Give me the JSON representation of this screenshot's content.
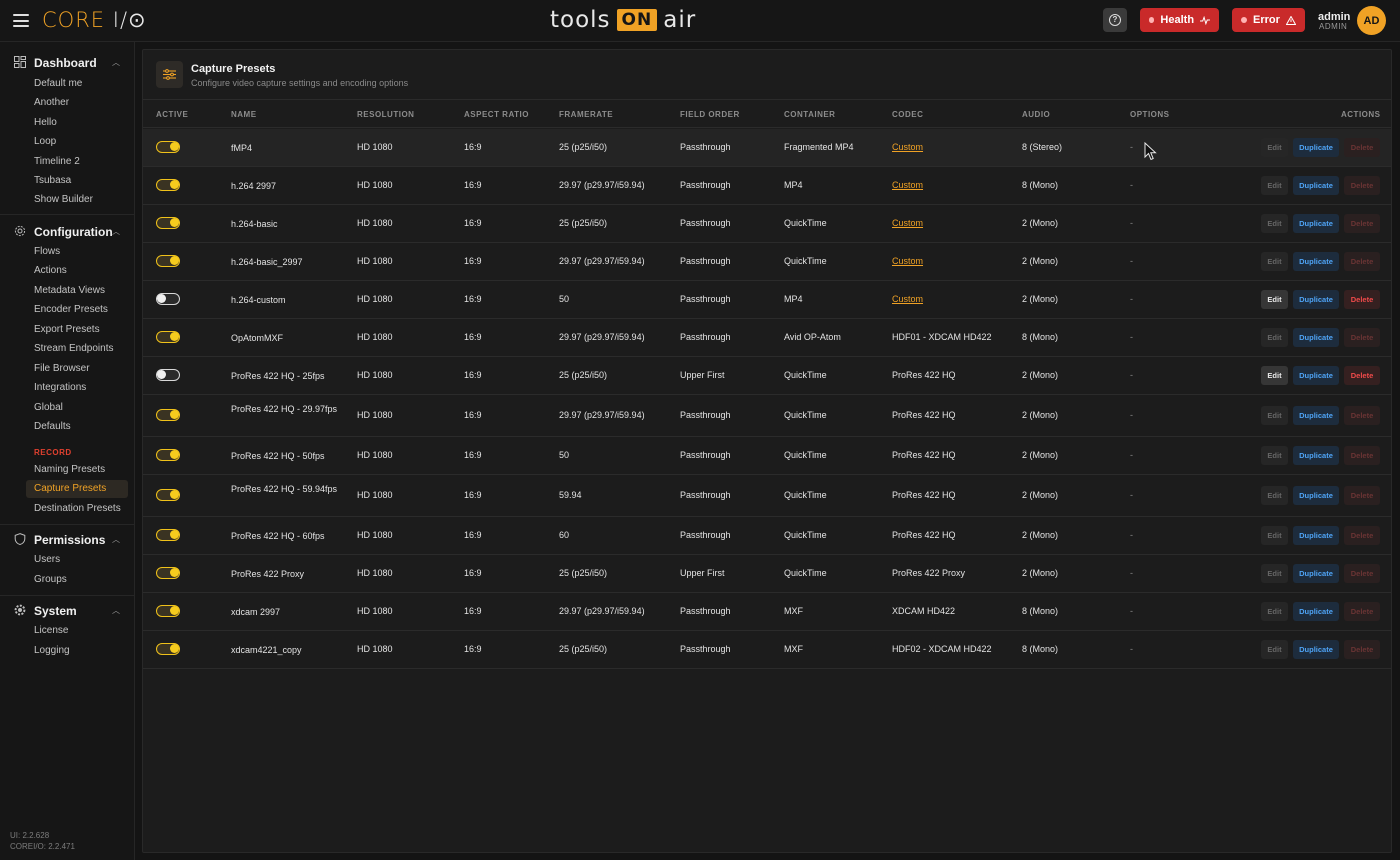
{
  "app": {
    "brand_core": "CORE",
    "brand_io": "I/⊙",
    "partner_logo": "tools",
    "partner_logo_on": "ON",
    "partner_logo_air": "air"
  },
  "topbar": {
    "health_label": "Health",
    "error_label": "Error",
    "user_name": "admin",
    "user_role": "ADMIN",
    "avatar_initials": "AD"
  },
  "sidebar": {
    "dashboard": {
      "label": "Dashboard",
      "items": [
        "Default me",
        "Another",
        "Hello",
        "Loop",
        "Timeline 2",
        "Tsubasa",
        "Show Builder"
      ]
    },
    "configuration": {
      "label": "Configuration",
      "items": [
        "Flows",
        "Actions",
        "Metadata Views",
        "Encoder Presets",
        "Export Presets",
        "Stream Endpoints",
        "File Browser",
        "Integrations",
        "Global",
        "Defaults"
      ]
    },
    "record": {
      "label": "RECORD",
      "items": [
        "Naming Presets",
        "Capture Presets",
        "Destination Presets"
      ]
    },
    "permissions": {
      "label": "Permissions",
      "items": [
        "Users",
        "Groups"
      ]
    },
    "system": {
      "label": "System",
      "items": [
        "License",
        "Logging"
      ]
    },
    "version_ui": "UI: 2.2.628",
    "version_core": "COREI/O: 2.2.471"
  },
  "page": {
    "title": "Capture Presets",
    "subtitle": "Configure video capture settings and encoding options"
  },
  "table": {
    "headers": {
      "active": "ACTIVE",
      "name": "NAME",
      "resolution": "RESOLUTION",
      "aspect": "ASPECT RATIO",
      "framerate": "FRAMERATE",
      "field_order": "FIELD ORDER",
      "container": "CONTAINER",
      "codec": "CODEC",
      "audio": "AUDIO",
      "options": "OPTIONS",
      "actions": "ACTIONS"
    },
    "button_labels": {
      "edit": "Edit",
      "duplicate": "Duplicate",
      "delete": "Delete"
    },
    "rows": [
      {
        "active": true,
        "name": "fMP4",
        "resolution": "HD 1080",
        "aspect": "16:9",
        "framerate": "25 (p25/i50)",
        "field_order": "Passthrough",
        "container": "Fragmented MP4",
        "codec": "Custom",
        "codec_link": true,
        "audio": "8 (Stereo)",
        "options": "-"
      },
      {
        "active": true,
        "name": "h.264 2997",
        "resolution": "HD 1080",
        "aspect": "16:9",
        "framerate": "29.97 (p29.97/i59.94)",
        "field_order": "Passthrough",
        "container": "MP4",
        "codec": "Custom",
        "codec_link": true,
        "audio": "8 (Mono)",
        "options": "-"
      },
      {
        "active": true,
        "name": "h.264-basic",
        "resolution": "HD 1080",
        "aspect": "16:9",
        "framerate": "25 (p25/i50)",
        "field_order": "Passthrough",
        "container": "QuickTime",
        "codec": "Custom",
        "codec_link": true,
        "audio": "2 (Mono)",
        "options": "-"
      },
      {
        "active": true,
        "name": "h.264-basic_2997",
        "resolution": "HD 1080",
        "aspect": "16:9",
        "framerate": "29.97 (p29.97/i59.94)",
        "field_order": "Passthrough",
        "container": "QuickTime",
        "codec": "Custom",
        "codec_link": true,
        "audio": "2 (Mono)",
        "options": "-"
      },
      {
        "active": false,
        "name": "h.264-custom",
        "resolution": "HD 1080",
        "aspect": "16:9",
        "framerate": "50",
        "field_order": "Passthrough",
        "container": "MP4",
        "codec": "Custom",
        "codec_link": true,
        "audio": "2 (Mono)",
        "options": "-"
      },
      {
        "active": true,
        "name": "OpAtomMXF",
        "resolution": "HD 1080",
        "aspect": "16:9",
        "framerate": "29.97 (p29.97/i59.94)",
        "field_order": "Passthrough",
        "container": "Avid OP-Atom",
        "codec": "HDF01 - XDCAM HD422",
        "codec_link": false,
        "audio": "8 (Mono)",
        "options": "-"
      },
      {
        "active": false,
        "name": "ProRes 422 HQ - 25fps",
        "resolution": "HD 1080",
        "aspect": "16:9",
        "framerate": "25 (p25/i50)",
        "field_order": "Upper First",
        "container": "QuickTime",
        "codec": "ProRes 422 HQ",
        "codec_link": false,
        "audio": "2 (Mono)",
        "options": "-"
      },
      {
        "active": true,
        "name": "ProRes 422 HQ - 29.97fps",
        "resolution": "HD 1080",
        "aspect": "16:9",
        "framerate": "29.97 (p29.97/i59.94)",
        "field_order": "Passthrough",
        "container": "QuickTime",
        "codec": "ProRes 422 HQ",
        "codec_link": false,
        "audio": "2 (Mono)",
        "options": "-"
      },
      {
        "active": true,
        "name": "ProRes 422 HQ - 50fps",
        "resolution": "HD 1080",
        "aspect": "16:9",
        "framerate": "50",
        "field_order": "Passthrough",
        "container": "QuickTime",
        "codec": "ProRes 422 HQ",
        "codec_link": false,
        "audio": "2 (Mono)",
        "options": "-"
      },
      {
        "active": true,
        "name": "ProRes 422 HQ - 59.94fps",
        "resolution": "HD 1080",
        "aspect": "16:9",
        "framerate": "59.94",
        "field_order": "Passthrough",
        "container": "QuickTime",
        "codec": "ProRes 422 HQ",
        "codec_link": false,
        "audio": "2 (Mono)",
        "options": "-"
      },
      {
        "active": true,
        "name": "ProRes 422 HQ - 60fps",
        "resolution": "HD 1080",
        "aspect": "16:9",
        "framerate": "60",
        "field_order": "Passthrough",
        "container": "QuickTime",
        "codec": "ProRes 422 HQ",
        "codec_link": false,
        "audio": "2 (Mono)",
        "options": "-"
      },
      {
        "active": true,
        "name": "ProRes 422 Proxy",
        "resolution": "HD 1080",
        "aspect": "16:9",
        "framerate": "25 (p25/i50)",
        "field_order": "Upper First",
        "container": "QuickTime",
        "codec": "ProRes 422 Proxy",
        "codec_link": false,
        "audio": "2 (Mono)",
        "options": "-"
      },
      {
        "active": true,
        "name": "xdcam 2997",
        "resolution": "HD 1080",
        "aspect": "16:9",
        "framerate": "29.97 (p29.97/i59.94)",
        "field_order": "Passthrough",
        "container": "MXF",
        "codec": "XDCAM HD422",
        "codec_link": false,
        "audio": "8 (Mono)",
        "options": "-"
      },
      {
        "active": true,
        "name": "xdcam4221_copy",
        "resolution": "HD 1080",
        "aspect": "16:9",
        "framerate": "25 (p25/i50)",
        "field_order": "Passthrough",
        "container": "MXF",
        "codec": "HDF02 - XDCAM HD422",
        "codec_link": false,
        "audio": "8 (Mono)",
        "options": "-"
      }
    ]
  },
  "colors": {
    "accent": "#f0a225",
    "danger": "#c92a2a",
    "link_blue": "#4ea3f5",
    "toggle_on": "#f5cb1e"
  }
}
